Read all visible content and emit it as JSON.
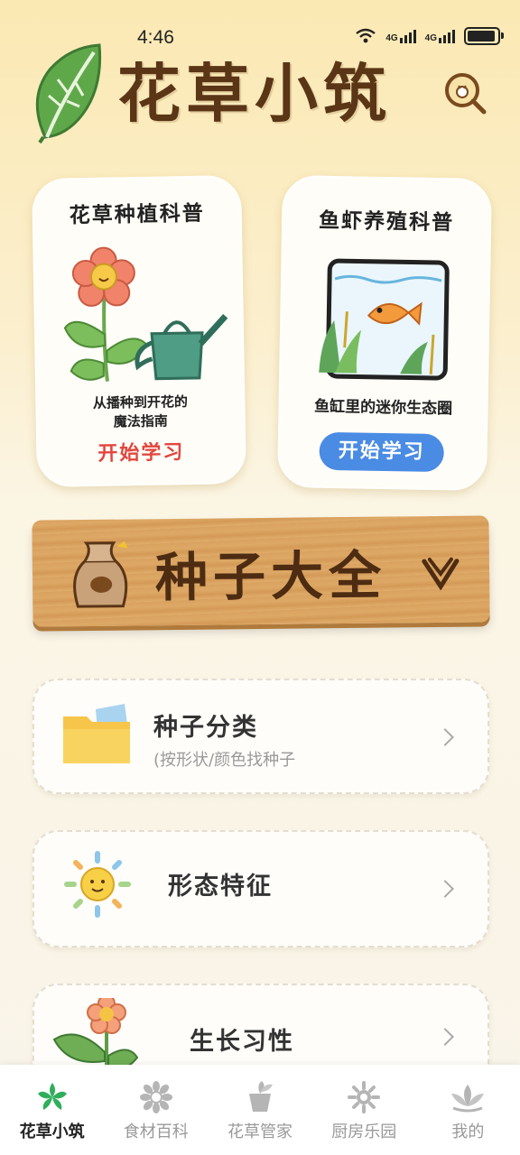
{
  "status_bar": {
    "time": "4:46",
    "network1": "4G",
    "network2": "4G"
  },
  "header": {
    "title": "花草小筑"
  },
  "cards": [
    {
      "title": "花草种植科普",
      "description": "从播种到开花的\n魔法指南",
      "button": "开始学习",
      "accent": "#e2463e"
    },
    {
      "title": "鱼虾养殖科普",
      "description": "鱼缸里的迷你生态圈",
      "button": "开始学习",
      "accent": "#4a8be4"
    }
  ],
  "banner": {
    "title": "种子大全"
  },
  "list": [
    {
      "title": "种子分类",
      "subtitle": "(按形状/颜色找种子"
    },
    {
      "title": "形态特征"
    },
    {
      "title": "生长习性"
    }
  ],
  "nav": [
    {
      "label": "花草小筑",
      "icon": "leaf-icon",
      "active": true
    },
    {
      "label": "食材百科",
      "icon": "flower-icon",
      "active": false
    },
    {
      "label": "花草管家",
      "icon": "plant-pot-icon",
      "active": false
    },
    {
      "label": "厨房乐园",
      "icon": "sunflower-icon",
      "active": false
    },
    {
      "label": "我的",
      "icon": "lotus-icon",
      "active": false
    }
  ]
}
